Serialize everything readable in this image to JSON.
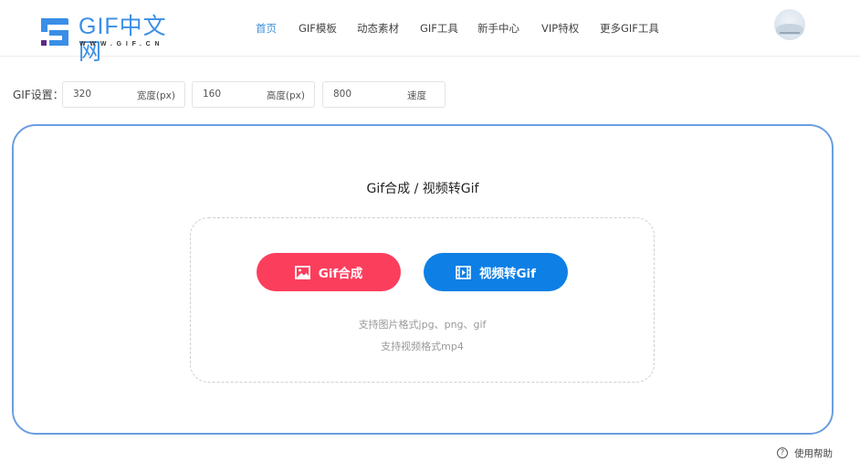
{
  "brand": {
    "name": "GIF中文网",
    "domain": "WWW.GIF.CN",
    "primary_color": "#3a8ee6",
    "accent_color": "#5b2a86"
  },
  "nav": {
    "items": [
      {
        "label": "首页",
        "active": true
      },
      {
        "label": "GIF模板",
        "active": false
      },
      {
        "label": "动态素材",
        "active": false
      },
      {
        "label": "GIF工具",
        "active": false
      },
      {
        "label": "新手中心",
        "active": false
      },
      {
        "label": "VIP特权",
        "active": false
      },
      {
        "label": "更多GIF工具",
        "active": false
      }
    ],
    "active_color": "#3d8fd9"
  },
  "user": {
    "avatar_icon": "user-avatar"
  },
  "settings": {
    "label": "GIF设置：",
    "width": {
      "value": "320",
      "unit": "宽度(px)"
    },
    "height": {
      "value": "160",
      "unit": "高度(px)"
    },
    "speed": {
      "value": "800",
      "unit": "速度"
    }
  },
  "panel": {
    "title": "Gif合成 / 视频转Gif",
    "merge_button": {
      "label": "Gif合成",
      "icon": "image-icon",
      "color": "#fc3e5d"
    },
    "video_button": {
      "label": "视频转Gif",
      "icon": "film-icon",
      "color": "#0d7fe5"
    },
    "hint_images": "支持图片格式jpg、png、gif",
    "hint_video": "支持视频格式mp4"
  },
  "help": {
    "icon": "question-circle-icon",
    "icon_glyph": "?",
    "label": "使用帮助"
  }
}
